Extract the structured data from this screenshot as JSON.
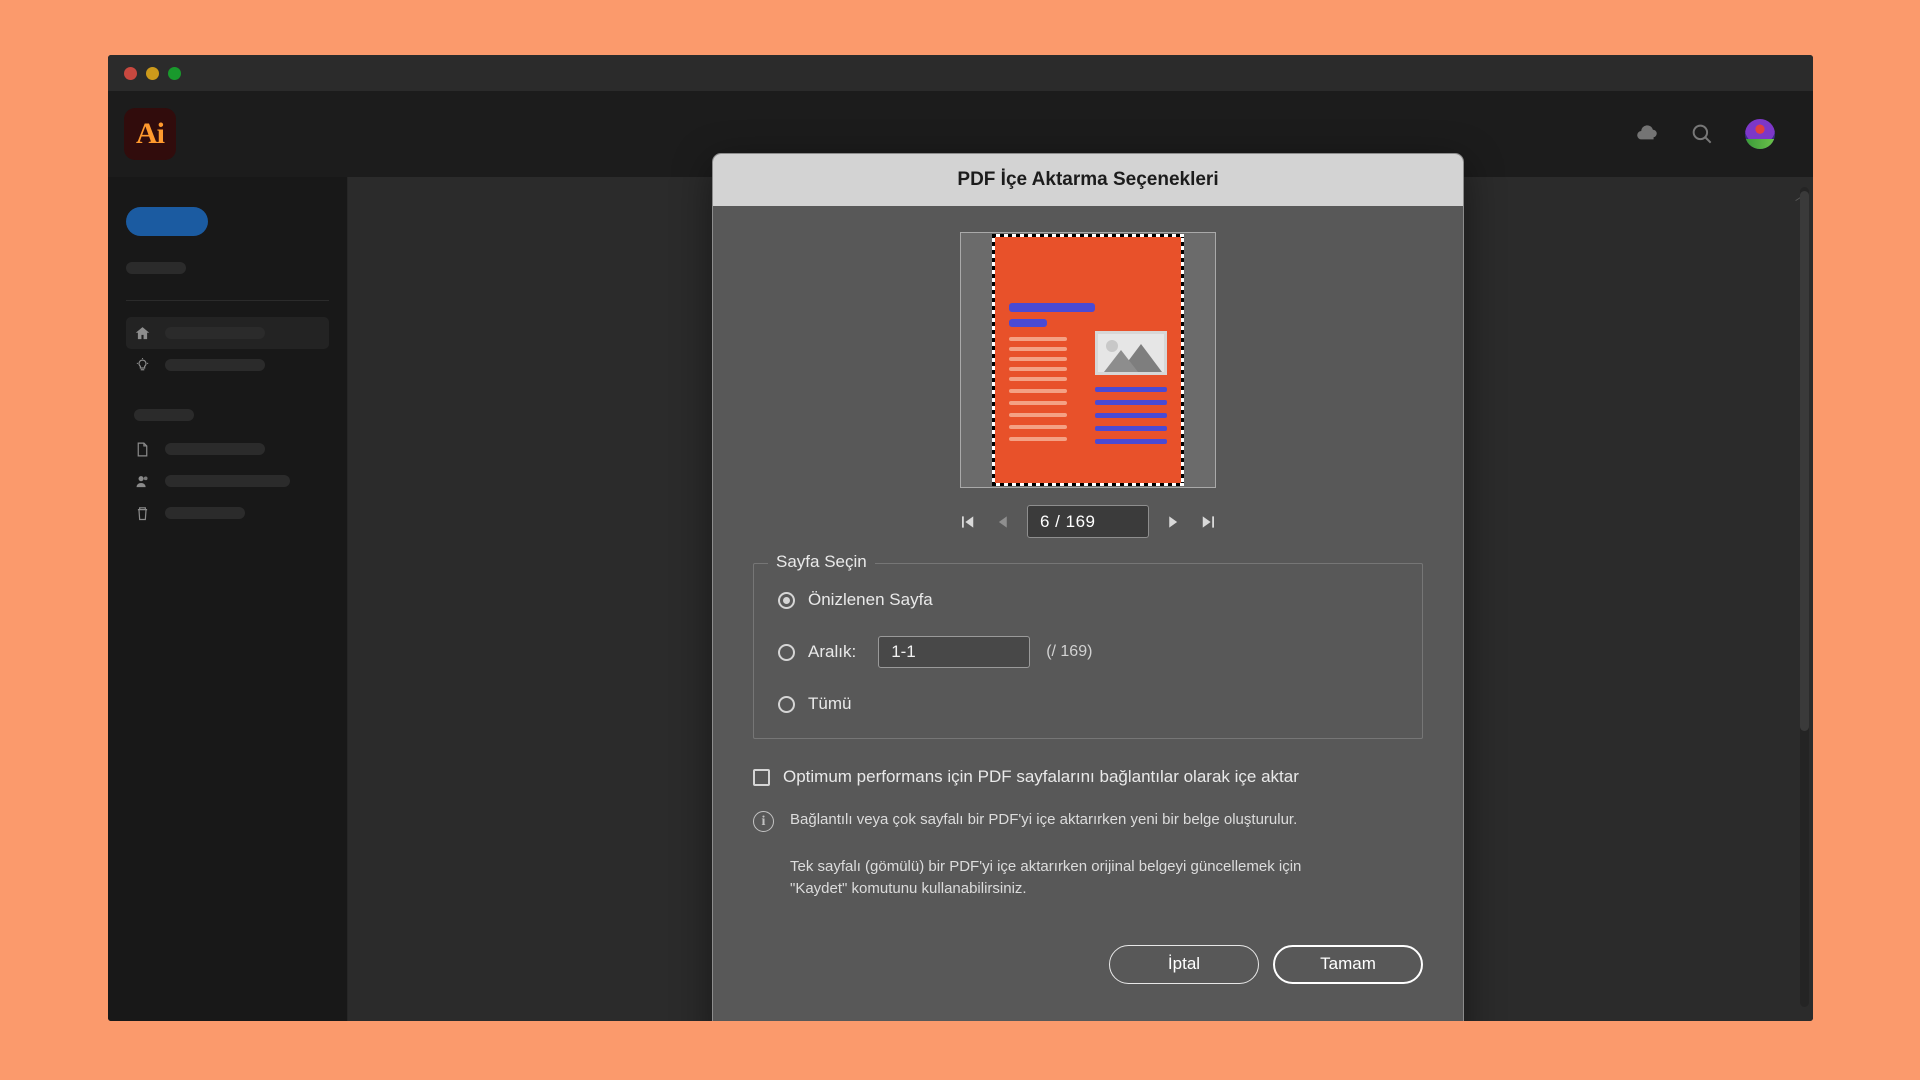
{
  "desktop": {
    "background_color": "#fb9a6c"
  },
  "app": {
    "name": "Adobe Illustrator",
    "logo_text": "Ai",
    "window_controls": [
      {
        "name": "close",
        "color": "#c8483f"
      },
      {
        "name": "minimize",
        "color": "#cc9a1b"
      },
      {
        "name": "maximize",
        "color": "#19992c"
      }
    ],
    "topbar_icons": [
      "cloud-icon",
      "search-icon",
      "avatar"
    ]
  },
  "sidebar": {
    "new_button_label": "",
    "items": [
      {
        "icon": "home-icon",
        "label": "",
        "active": true
      },
      {
        "icon": "lightbulb-icon",
        "label": "",
        "active": false
      },
      {
        "icon": "document-icon",
        "label": "",
        "active": false
      },
      {
        "icon": "user-icon",
        "label": "",
        "active": false
      },
      {
        "icon": "trash-icon",
        "label": "",
        "active": false
      }
    ]
  },
  "dialog": {
    "title": "PDF İçe Aktarma Seçenekleri",
    "preview": {
      "page_color": "#e8512a",
      "heading_color": "#4a4ad4",
      "text_line_color": "#f4a184",
      "frame_color": "#6b6b6b",
      "selection": "marching-ants"
    },
    "pager": {
      "first_label": "|◀",
      "prev_label": "◀",
      "value": "6 / 169",
      "next_label": "▶",
      "last_label": "▶|",
      "current_page": 6,
      "total_pages": 169,
      "prev_disabled": true
    },
    "page_select": {
      "legend": "Sayfa Seçin",
      "options": [
        {
          "label": "Önizlenen Sayfa",
          "selected": true
        },
        {
          "label": "Aralık:",
          "selected": false
        },
        {
          "label": "Tümü",
          "selected": false
        }
      ],
      "range_value": "1-1",
      "range_total": "(/ 169)"
    },
    "link_import": {
      "label": "Optimum performans için PDF sayfalarını bağlantılar olarak içe aktar",
      "checked": false
    },
    "info": {
      "icon": "i",
      "paragraph_1": "Bağlantılı veya çok sayfalı bir PDF'yi içe aktarırken yeni bir belge oluşturulur.",
      "paragraph_2": "Tek sayfalı (gömülü) bir PDF'yi içe aktarırken orijinal belgeyi güncellemek için \"Kaydet\" komutunu kullanabilirsiniz."
    },
    "buttons": {
      "cancel": "İptal",
      "ok": "Tamam"
    }
  }
}
